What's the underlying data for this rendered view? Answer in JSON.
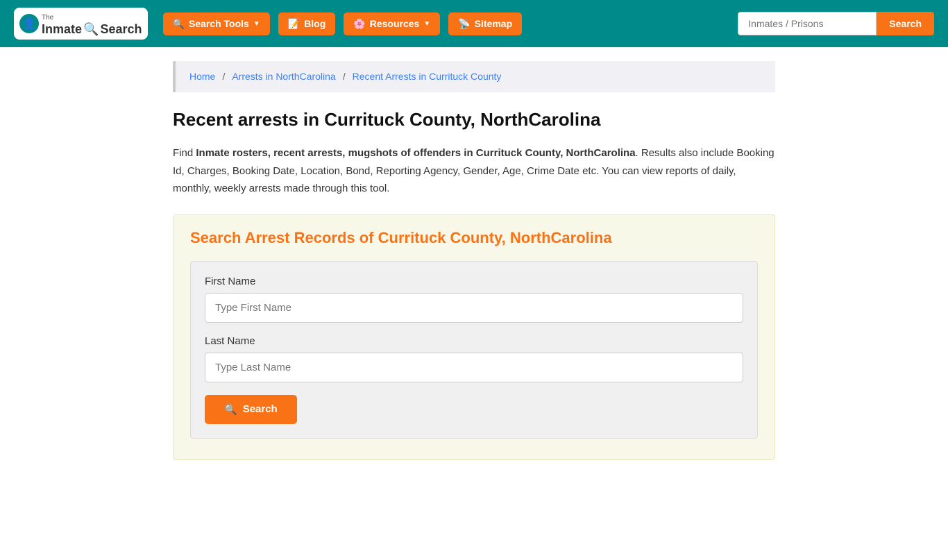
{
  "header": {
    "logo": {
      "the": "The",
      "inmate": "Inmate",
      "search": "Search"
    },
    "nav": [
      {
        "label": "Search Tools",
        "icon": "🔍",
        "hasDropdown": true
      },
      {
        "label": "Blog",
        "icon": "📝",
        "hasDropdown": false
      },
      {
        "label": "Resources",
        "icon": "🌸",
        "hasDropdown": true
      },
      {
        "label": "Sitemap",
        "icon": "📡",
        "hasDropdown": false
      }
    ],
    "search": {
      "placeholder": "Inmates / Prisons",
      "button_label": "Search"
    }
  },
  "breadcrumb": {
    "items": [
      {
        "label": "Home",
        "href": "#"
      },
      {
        "label": "Arrests in NorthCarolina",
        "href": "#"
      },
      {
        "label": "Recent Arrests in Currituck County",
        "href": "#"
      }
    ]
  },
  "main": {
    "page_title": "Recent arrests in Currituck County, NorthCarolina",
    "description_bold": "Inmate rosters, recent arrests, mugshots of offenders in Currituck County, NorthCarolina",
    "description_rest": ". Results also include Booking Id, Charges, Booking Date, Location, Bond, Reporting Agency, Gender, Age, Crime Date etc. You can view reports of daily, monthly, weekly arrests made through this tool.",
    "search_form_title": "Search Arrest Records of Currituck County, NorthCarolina",
    "form": {
      "first_name_label": "First Name",
      "first_name_placeholder": "Type First Name",
      "last_name_label": "Last Name",
      "last_name_placeholder": "Type Last Name",
      "search_button": "Search"
    }
  }
}
